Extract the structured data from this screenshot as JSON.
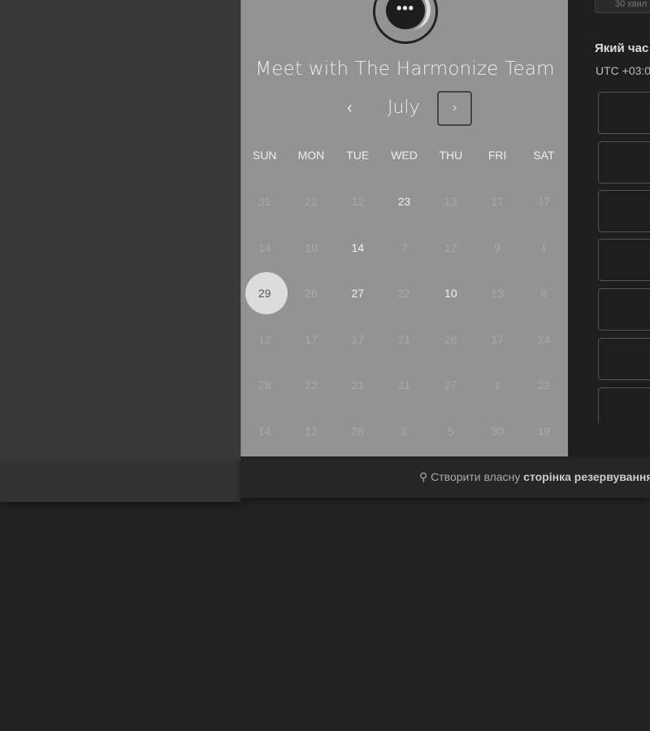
{
  "title": "Meet with The Harmonize Team",
  "month": "July",
  "nav": {
    "prev": "‹",
    "next": "›"
  },
  "weekdays": [
    "SUN",
    "MON",
    "TUE",
    "WED",
    "THU",
    "FRI",
    "SAT"
  ],
  "weeks": [
    [
      "31",
      "22",
      "12",
      "23",
      "13",
      "17",
      "17"
    ],
    [
      "14",
      "10",
      "14",
      "7",
      "12",
      "9",
      "1"
    ],
    [
      "29",
      "26",
      "27",
      "22",
      "10",
      "13",
      "8"
    ],
    [
      "12",
      "17",
      "17",
      "21",
      "26",
      "17",
      "24"
    ],
    [
      "28",
      "22",
      "21",
      "21",
      "27",
      "1",
      "22"
    ],
    [
      "14",
      "13",
      "28",
      "1",
      "5",
      "30",
      "19"
    ]
  ],
  "available": [
    [
      0,
      3
    ],
    [
      1,
      2
    ],
    [
      2,
      2
    ],
    [
      2,
      4
    ]
  ],
  "selected": [
    2,
    0
  ],
  "right": {
    "duration": "30 хвил",
    "question": "Який час",
    "timezone": "UTC +03:0"
  },
  "footer": {
    "icon": "hubspot-sprocket-icon",
    "text": "Створити власну ",
    "bold": "сторінка резервування"
  }
}
